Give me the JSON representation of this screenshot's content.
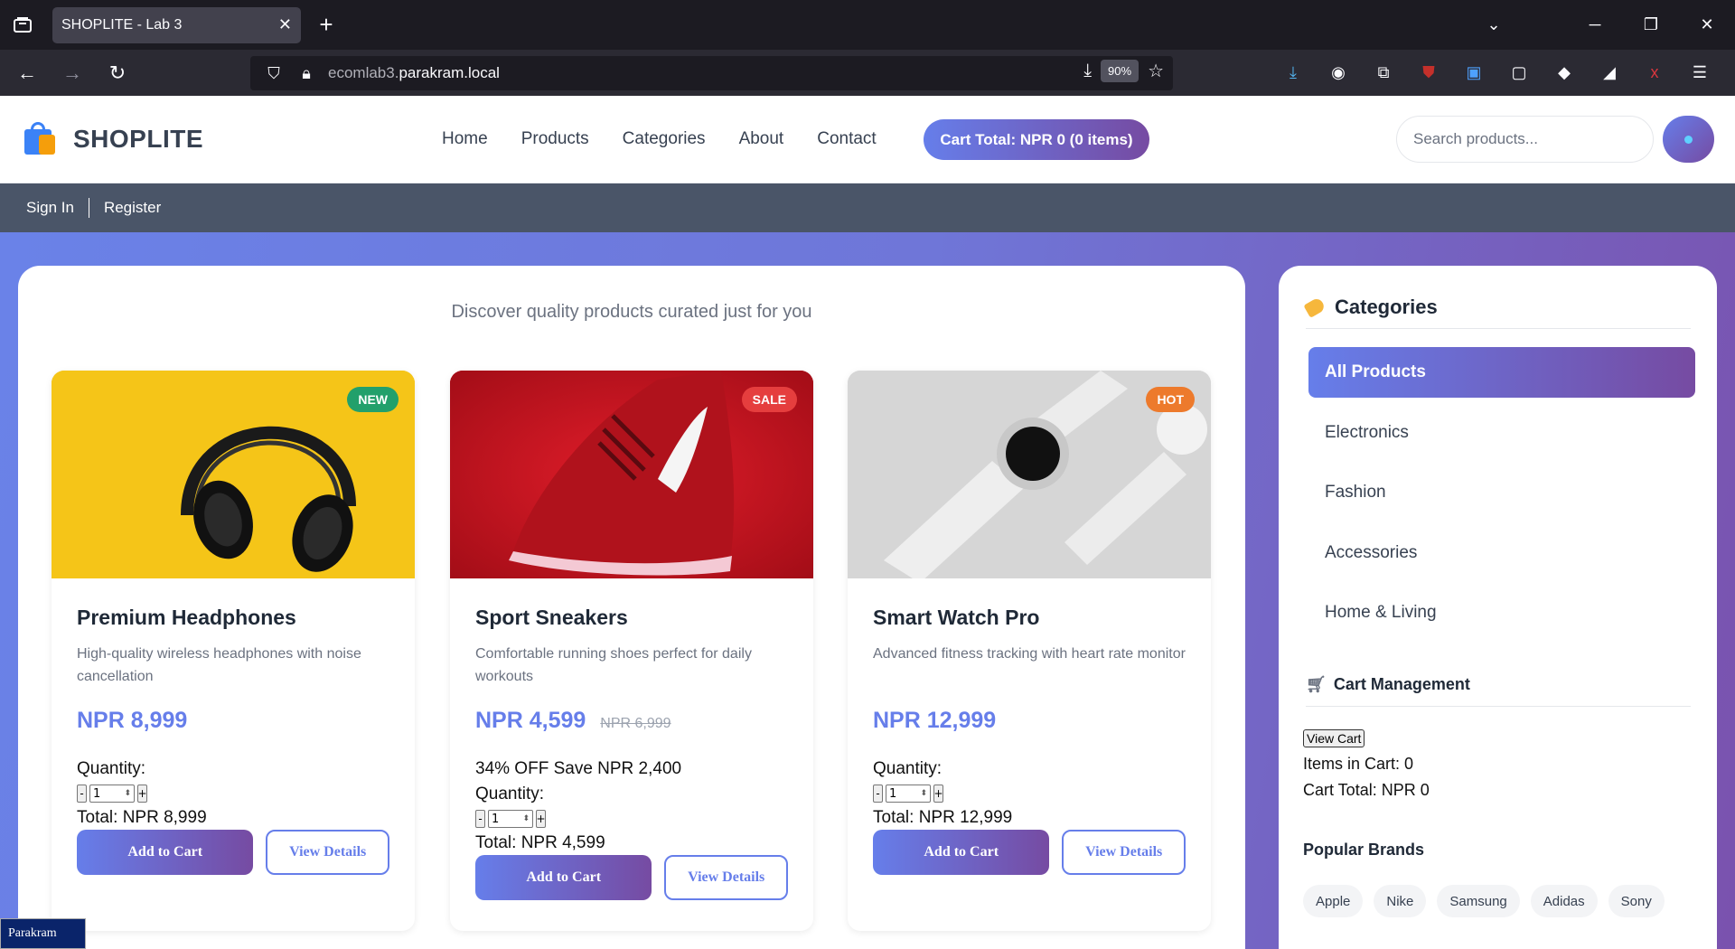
{
  "browser": {
    "tab_title": "SHOPLITE - Lab 3",
    "url_subdomain": "ecomlab3.",
    "url_host": "parakram.local",
    "zoom": "90%"
  },
  "site": {
    "brand": "SHOPLITE",
    "nav": [
      "Home",
      "Products",
      "Categories",
      "About",
      "Contact"
    ],
    "cart_total_label": "Cart Total: NPR 0 (0 items)",
    "search_placeholder": "Search products...",
    "auth": {
      "sign_in": "Sign In",
      "register": "Register"
    }
  },
  "main": {
    "subtitle": "Discover quality products curated just for you",
    "products": [
      {
        "badge": "NEW",
        "badge_color": "#22a06b",
        "name": "Premium Headphones",
        "description": "High-quality wireless headphones with noise cancellation",
        "price": "NPR 8,999",
        "old_price": "",
        "discount": "",
        "quantity_label": "Quantity:",
        "quantity": "1",
        "total": "Total: NPR 8,999",
        "add_label": "Add to Cart",
        "view_label": "View Details"
      },
      {
        "badge": "SALE",
        "badge_color": "#e53e3e",
        "name": "Sport Sneakers",
        "description": "Comfortable running shoes perfect for daily workouts",
        "price": "NPR 4,599",
        "old_price": "NPR 6,999",
        "discount": "34% OFF Save NPR 2,400",
        "quantity_label": "Quantity:",
        "quantity": "1",
        "total": "Total: NPR 4,599",
        "add_label": "Add to Cart",
        "view_label": "View Details"
      },
      {
        "badge": "HOT",
        "badge_color": "#ed7a2c",
        "name": "Smart Watch Pro",
        "description": "Advanced fitness tracking with heart rate monitor",
        "price": "NPR 12,999",
        "old_price": "",
        "discount": "",
        "quantity_label": "Quantity:",
        "quantity": "1",
        "total": "Total: NPR 12,999",
        "add_label": "Add to Cart",
        "view_label": "View Details"
      }
    ]
  },
  "sidebar": {
    "categories_title": "Categories",
    "categories": [
      "All Products",
      "Electronics",
      "Fashion",
      "Accessories",
      "Home & Living"
    ],
    "cart_title": "Cart Management",
    "view_cart": "View Cart",
    "items_in_cart": "Items in Cart: 0",
    "cart_total": "Cart Total: NPR 0",
    "brands_title": "Popular Brands",
    "brands": [
      "Apple",
      "Nike",
      "Samsung",
      "Adidas",
      "Sony"
    ]
  },
  "taskbar": {
    "label": "Parakram"
  },
  "colors": {
    "accent_start": "#667eea",
    "accent_end": "#764ba2"
  }
}
